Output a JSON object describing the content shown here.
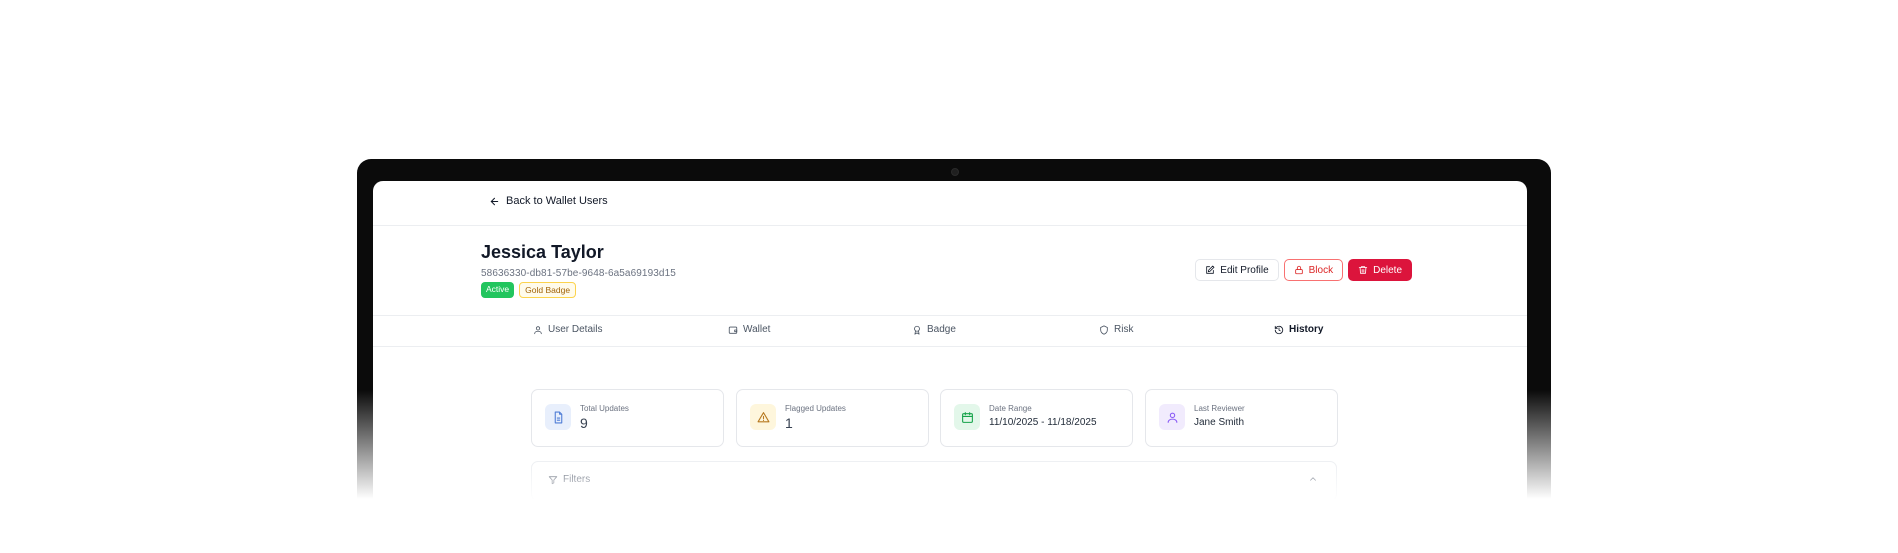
{
  "nav": {
    "back_label": "Back to Wallet Users"
  },
  "user": {
    "name": "Jessica Taylor",
    "id": "58636330-db81-57be-9648-6a5a69193d15",
    "badges": [
      "Active",
      "Gold Badge"
    ]
  },
  "actions": {
    "edit_label": "Edit Profile",
    "block_label": "Block",
    "delete_label": "Delete"
  },
  "tabs": [
    {
      "label": "User Details",
      "icon": "user-icon"
    },
    {
      "label": "Wallet",
      "icon": "wallet-icon"
    },
    {
      "label": "Badge",
      "icon": "award-icon"
    },
    {
      "label": "Risk",
      "icon": "shield-icon"
    },
    {
      "label": "History",
      "icon": "history-icon",
      "active": true
    }
  ],
  "stats": [
    {
      "label": "Total Updates",
      "value": "9",
      "icon": "document-icon",
      "color": "#4f7dd6",
      "bg": "#e8effc"
    },
    {
      "label": "Flagged Updates",
      "value": "1",
      "icon": "warning-icon",
      "color": "#b7791f",
      "bg": "#fef6dc"
    },
    {
      "label": "Date Range",
      "value": "11/10/2025 - 11/18/2025",
      "icon": "calendar-icon",
      "color": "#16a34a",
      "bg": "#e3f7ea"
    },
    {
      "label": "Last Reviewer",
      "value": "Jane Smith",
      "icon": "user-icon",
      "color": "#8b5cf6",
      "bg": "#f1ebfd"
    }
  ],
  "filters": {
    "label": "Filters"
  },
  "colors": {
    "active_badge": "#22c55e",
    "gold_badge_border": "#fcd34d",
    "block_border": "#f87171",
    "delete": "#dc143c"
  }
}
